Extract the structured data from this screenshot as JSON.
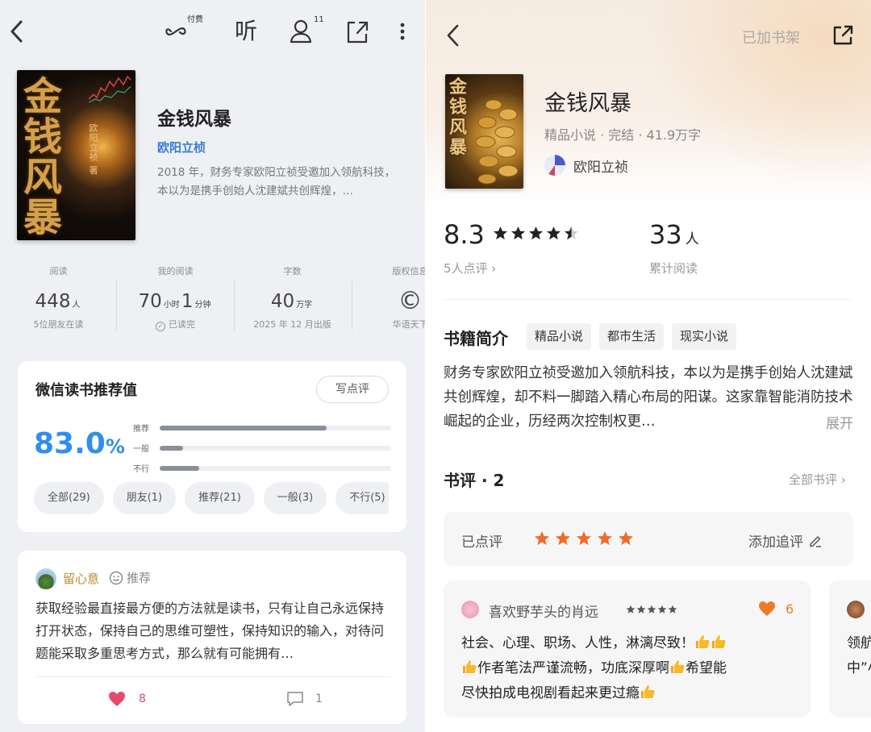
{
  "left": {
    "topbar": {
      "paid_label": "付费",
      "listen_label": "听",
      "users_count": "11"
    },
    "book": {
      "cover_title": "金钱风暴",
      "cover_author": "欧阳立祯 著",
      "title": "金钱风暴",
      "author": "欧阳立桢",
      "description": "2018 年，财务专家欧阳立祯受邀加入领航科技，本以为是携手创始人沈建斌共创辉煌，…"
    },
    "stats": [
      {
        "label": "阅读",
        "value": "448",
        "unit": "人",
        "sub": "5位朋友在读"
      },
      {
        "label": "我的阅读",
        "value_a": "70",
        "unit_a": "小时",
        "value_b": "1",
        "unit_b": "分钟",
        "sub": "已读完"
      },
      {
        "label": "字数",
        "value": "40",
        "unit": "万字",
        "sub": "2025 年 12 月出版"
      },
      {
        "label": "版权信息",
        "value": "©",
        "sub": "华语天下"
      }
    ],
    "recommend": {
      "title": "微信读书推荐值",
      "write_button": "写点评",
      "percent": "83.0",
      "percent_sign": "%",
      "bars": [
        {
          "label": "推荐",
          "fraction": 0.72
        },
        {
          "label": "一般",
          "fraction": 0.1
        },
        {
          "label": "不行",
          "fraction": 0.17
        }
      ],
      "filters": [
        "全部(29)",
        "朋友(1)",
        "推荐(21)",
        "一般(3)",
        "不行(5)"
      ]
    },
    "review": {
      "user": "留心意",
      "tag": "推荐",
      "text": "获取经验最直接最方便的方法就是读书，只有让自己永远保持打开状态，保持自己的思维可塑性，保持知识的输入，对待问题能采取多重思考方式，那么就有可能拥有…",
      "likes": "8",
      "comments": "1"
    }
  },
  "right": {
    "topbar": {
      "shelf_label": "已加书架"
    },
    "book": {
      "cover_title": "金钱风暴",
      "title": "金钱风暴",
      "meta": "精品小说 · 完结 · 41.9万字",
      "author": "欧阳立祯"
    },
    "rating": {
      "score": "8.3",
      "stars": 4.5,
      "count_label": "5人点评 ›"
    },
    "readers": {
      "count": "33",
      "unit": "人",
      "label": "累计阅读"
    },
    "intro": {
      "heading": "书籍简介",
      "tags": [
        "精品小说",
        "都市生活",
        "现实小说"
      ],
      "text": "财务专家欧阳立祯受邀加入领航科技，本以为是携手创始人沈建斌共创辉煌，却不料一脚踏入精心布局的阳谋。这家靠智能消防技术崛起的企业，历经两次控制权更…",
      "expand": "展开"
    },
    "reviews": {
      "heading": "书评 · 2",
      "all_label": "全部书评 ›",
      "rated_label": "已点评",
      "rated_stars": 5,
      "add_label": "添加追评",
      "card": {
        "user": "喜欢野芋头的肖远",
        "stars": 5,
        "likes": "6",
        "line1": "社会、心理、职场、人性，淋漓尽致！",
        "line2": "作者笔法严谨流畅，功底深厚啊",
        "line2b": "希望能",
        "line3": "尽快拍成电视剧看起来更过瘾"
      },
      "card2_text": "领航中”小说"
    }
  },
  "colors": {
    "accent_blue": "#2f8ff0",
    "star_orange": "#f06a2a",
    "like_pink": "#e64a6a"
  }
}
